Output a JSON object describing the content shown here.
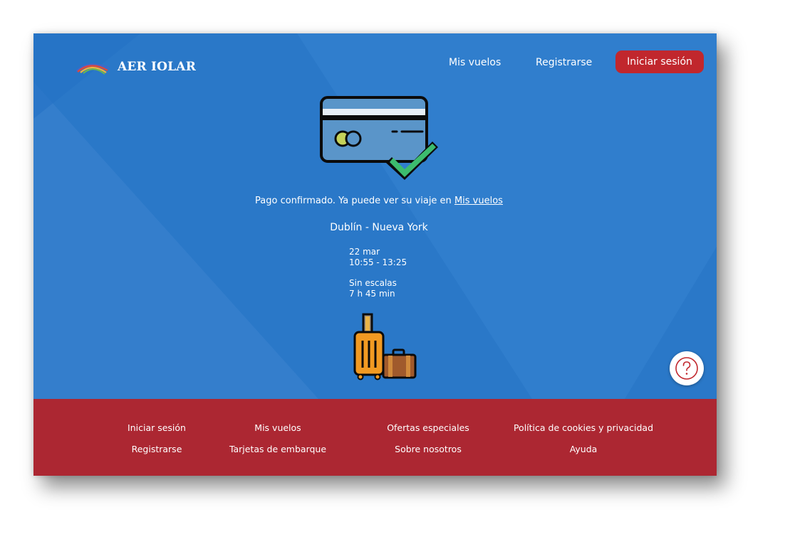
{
  "brand": {
    "name": "AER IOLAR"
  },
  "header": {
    "nav": {
      "my_flights": "Mis vuelos",
      "register": "Registrarse"
    },
    "login_label": "Iniciar sesión"
  },
  "confirmation": {
    "message": "Pago confirmado. Ya puede ver su viaje en",
    "link": "Mis vuelos"
  },
  "trip": {
    "route": "Dublín - Nueva York",
    "date": "22 mar",
    "times": "10:55 - 13:25",
    "stops": "Sin escalas",
    "duration": "7 h 45 min"
  },
  "help": {
    "icon": "question-icon"
  },
  "footer": {
    "col1": [
      "Iniciar sesión",
      "Registrarse"
    ],
    "col2": [
      "Mis vuelos",
      "Tarjetas de embarque"
    ],
    "col3": [
      "Ofertas especiales",
      "Sobre nosotros"
    ],
    "col4": [
      "Política de cookies y privacidad",
      "Ayuda"
    ]
  },
  "colors": {
    "hero_blue": "#2a78c8",
    "accent_red": "#c1272d",
    "footer_red": "#ac2732",
    "check_green": "#3cbc6e"
  }
}
